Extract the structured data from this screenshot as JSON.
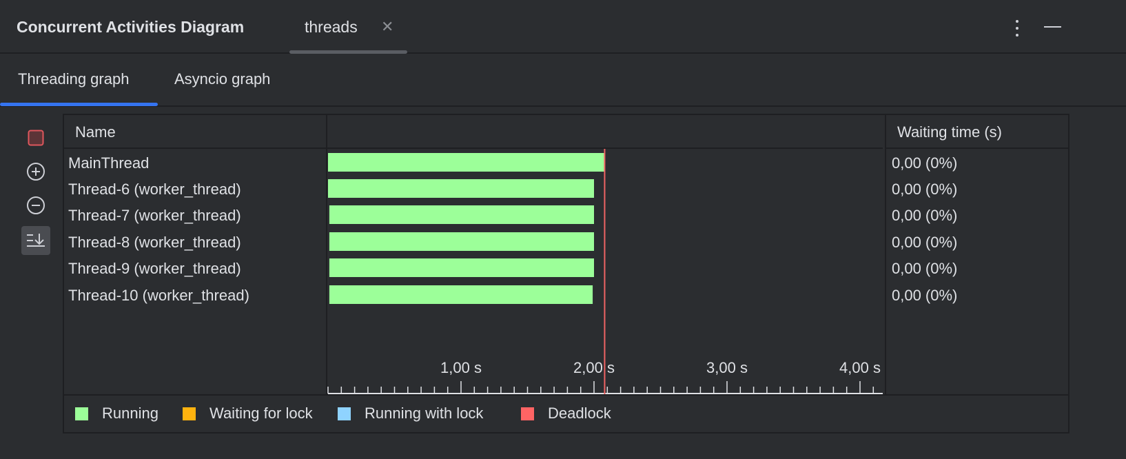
{
  "header": {
    "title": "Concurrent Activities Diagram",
    "tab": "threads",
    "close_icon": "close-icon",
    "more_icon": "more-vertical-icon",
    "minimize_icon": "minimize-icon"
  },
  "subtabs": [
    {
      "label": "Threading graph",
      "active": true
    },
    {
      "label": "Asyncio graph",
      "active": false
    }
  ],
  "toolbar": [
    {
      "icon": "stop-icon"
    },
    {
      "icon": "zoom-in-icon"
    },
    {
      "icon": "zoom-out-icon"
    },
    {
      "icon": "scroll-to-end-icon"
    }
  ],
  "table": {
    "columns": [
      "Name",
      "",
      "Waiting time (s)"
    ],
    "rows": [
      {
        "name": "MainThread",
        "waiting": "0,00 (0%)"
      },
      {
        "name": "Thread-6 (worker_thread)",
        "waiting": "0,00 (0%)"
      },
      {
        "name": "Thread-7 (worker_thread)",
        "waiting": "0,00 (0%)"
      },
      {
        "name": "Thread-8 (worker_thread)",
        "waiting": "0,00 (0%)"
      },
      {
        "name": "Thread-9 (worker_thread)",
        "waiting": "0,00 (0%)"
      },
      {
        "name": "Thread-10 (worker_thread)",
        "waiting": "0,00 (0%)"
      }
    ]
  },
  "chart_data": {
    "type": "bar",
    "orientation": "horizontal-timeline",
    "x_unit": "s",
    "xlim": [
      0,
      4.2
    ],
    "ticks": [
      {
        "value": 1,
        "label": "1,00 s"
      },
      {
        "value": 2,
        "label": "2,00 s"
      },
      {
        "value": 3,
        "label": "3,00 s"
      },
      {
        "value": 4,
        "label": "4,00 s"
      }
    ],
    "minor_tick_step": 0.1,
    "marker_time": 2.08,
    "series": [
      {
        "thread": "MainThread",
        "state": "Running",
        "start": 0,
        "end": 2.08
      },
      {
        "thread": "Thread-6 (worker_thread)",
        "state": "Running",
        "start": 0,
        "end": 2.0
      },
      {
        "thread": "Thread-7 (worker_thread)",
        "state": "Running",
        "start": 0.01,
        "end": 2.0
      },
      {
        "thread": "Thread-8 (worker_thread)",
        "state": "Running",
        "start": 0.01,
        "end": 2.0
      },
      {
        "thread": "Thread-9 (worker_thread)",
        "state": "Running",
        "start": 0.01,
        "end": 2.0
      },
      {
        "thread": "Thread-10 (worker_thread)",
        "state": "Running",
        "start": 0.01,
        "end": 1.99
      }
    ]
  },
  "legend": [
    {
      "label": "Running",
      "color": "#9cff99"
    },
    {
      "label": "Waiting for lock",
      "color": "#ffb30f"
    },
    {
      "label": "Running with lock",
      "color": "#8fd3ff"
    },
    {
      "label": "Deadlock",
      "color": "#ff6464"
    }
  ],
  "colors": {
    "accent": "#3574f0",
    "marker": "#f06464"
  }
}
